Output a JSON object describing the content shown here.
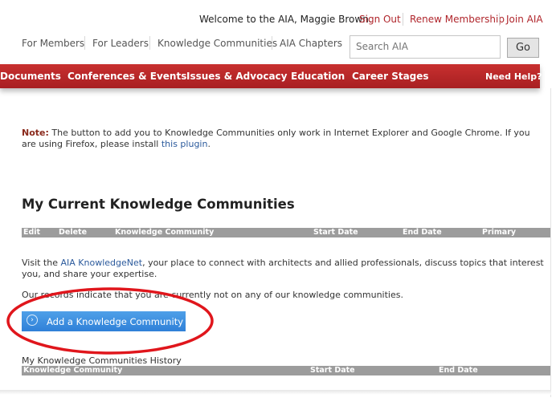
{
  "header": {
    "welcome": "Welcome to the AIA, Maggie Brown.",
    "sign_out": "Sign Out",
    "renew": "Renew Membership",
    "join": "Join AIA"
  },
  "subnav": {
    "members": "For Members",
    "leaders": "For Leaders",
    "kc": "Knowledge Communities",
    "chapters": "AIA Chapters"
  },
  "search": {
    "placeholder": "Search AIA",
    "go": "Go"
  },
  "mainnav": {
    "documents": "Documents",
    "conferences": "Conferences & Events",
    "issues": "Issues & Advocacy",
    "education": "Education",
    "career": "Career Stages",
    "help": "Need Help?"
  },
  "note": {
    "label": "Note:",
    "text": " The button to add you to Knowledge Communities only work in Internet Explorer and Google Chrome. If you are using Firefox, please install ",
    "link": "this plugin",
    "end": "."
  },
  "section_title": "My Current Knowledge Communities",
  "current_table": {
    "edit": "Edit",
    "delete": "Delete",
    "community": "Knowledge Community",
    "start": "Start Date",
    "end": "End Date",
    "primary": "Primary"
  },
  "visit": {
    "pre": "Visit the ",
    "link": "AIA KnowledgeNet",
    "post": ", your place to connect with architects and allied professionals, discuss topics that interest you, and share your expertise."
  },
  "records_text": "Our records indicate that you are currently not on any of our knowledge communities.",
  "add_button": "Add a Knowledge Community",
  "history": {
    "title": "My Knowledge Communities History",
    "community": "Knowledge Community",
    "start": "Start Date",
    "end": "End Date"
  },
  "colors": {
    "brand_red": "#b0262c",
    "link_blue": "#2b5a9c",
    "button_blue": "#3f8fe0",
    "annotation_red": "#e0161c"
  }
}
